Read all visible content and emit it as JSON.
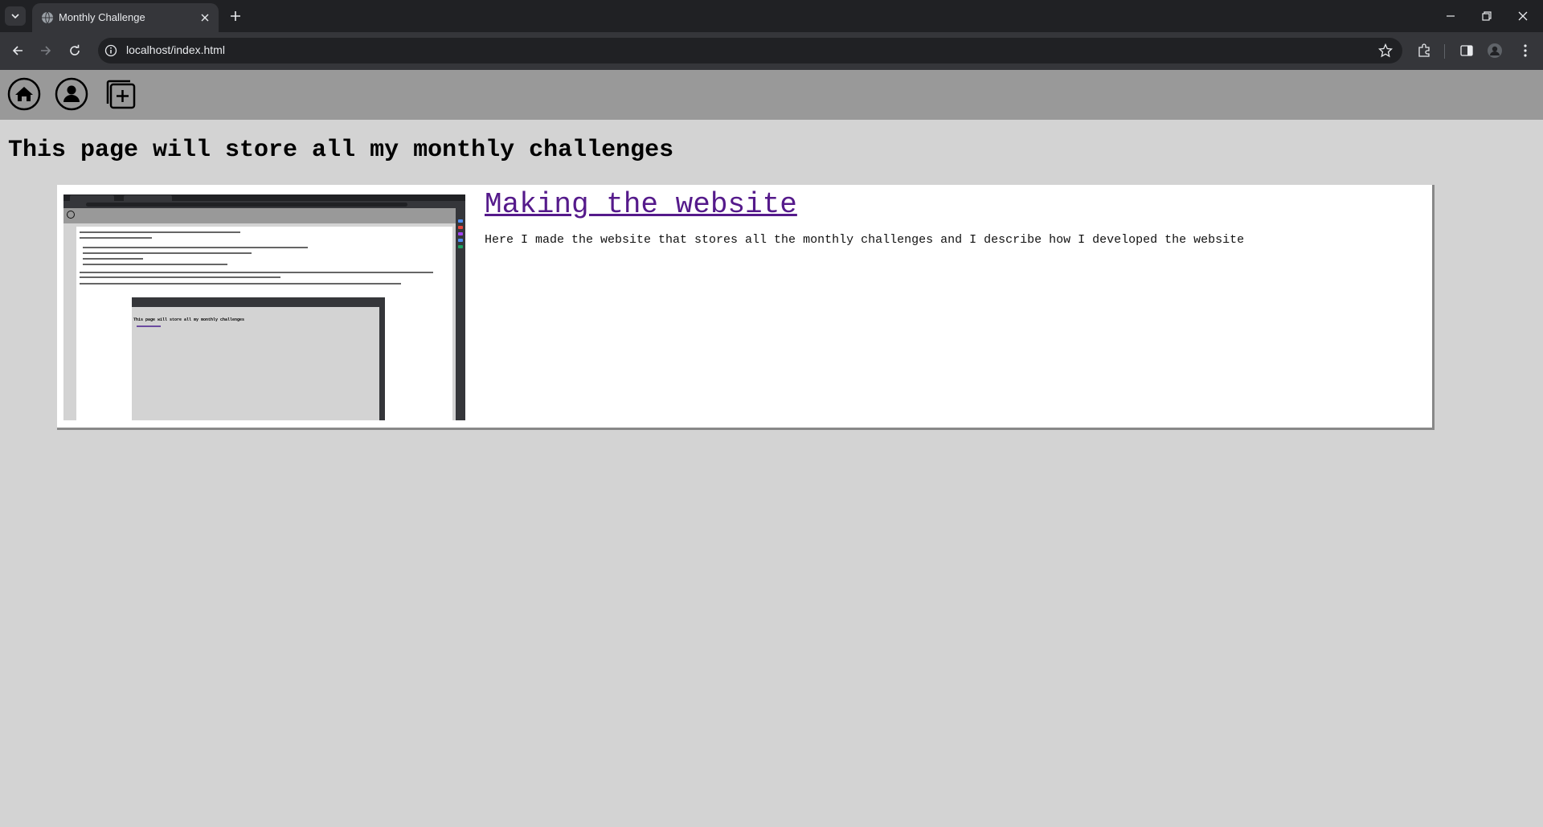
{
  "browser": {
    "tab_title": "Monthly Challenge",
    "url": "localhost/index.html",
    "colors": {
      "frame": "#202124",
      "toolbar": "#35363a",
      "text": "#e8eaed"
    }
  },
  "site": {
    "nav": {
      "items": [
        {
          "icon": "home-icon"
        },
        {
          "icon": "user-icon"
        },
        {
          "icon": "add-square-icon"
        }
      ],
      "background": "#999999"
    },
    "headline": "This page will store all my monthly challenges",
    "background": "#d3d3d3"
  },
  "challenges": [
    {
      "title": "Making the website",
      "description": "Here I made the website that stores all the monthly challenges and I describe how I developed the website",
      "thumbnail_icon": "website-screenshot-image",
      "link_color": "#551a8b"
    }
  ],
  "thumbnail_inner": {
    "headline": "This page will store all my monthly challenges"
  }
}
